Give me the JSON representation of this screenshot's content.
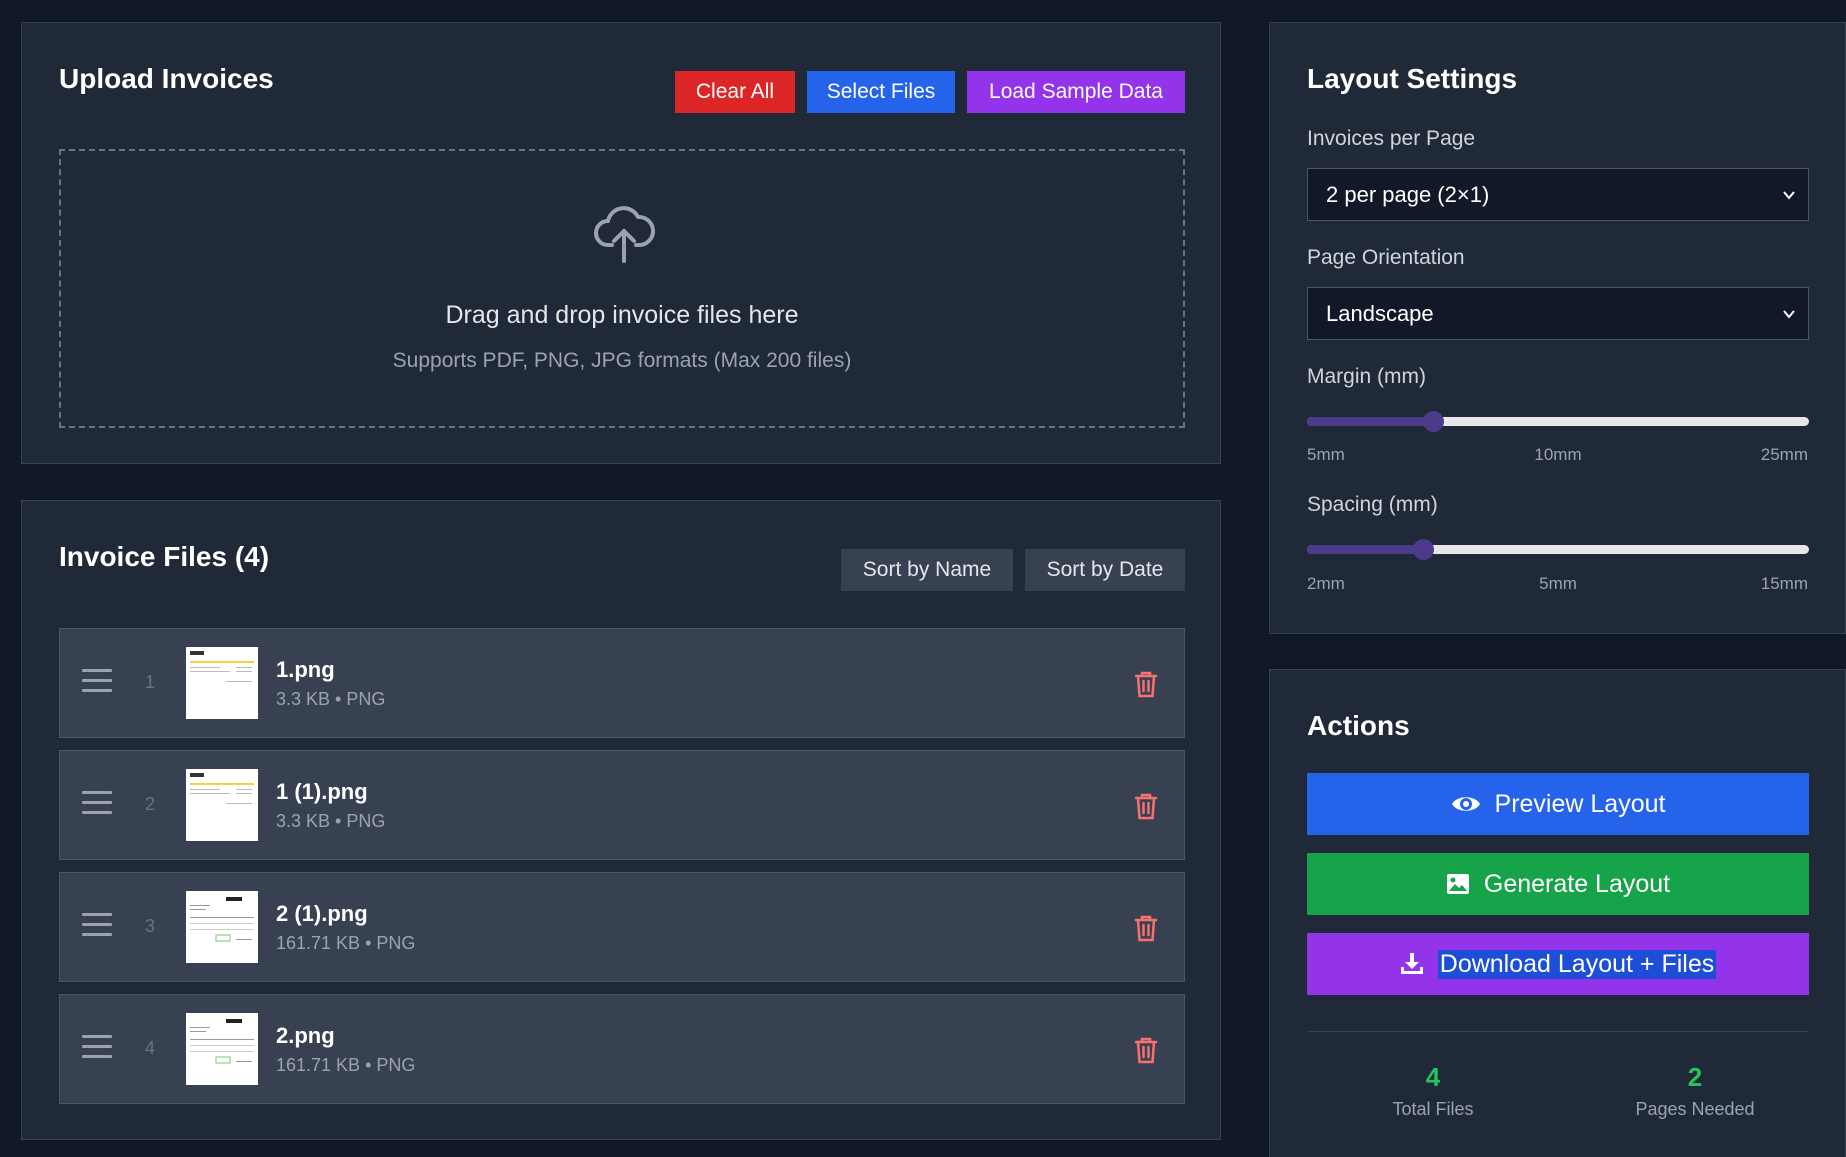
{
  "upload": {
    "title": "Upload Invoices",
    "clear_all": "Clear All",
    "select_files": "Select Files",
    "load_sample": "Load Sample Data",
    "drop_title": "Drag and drop invoice files here",
    "drop_subtitle": "Supports PDF, PNG, JPG formats (Max 200 files)"
  },
  "files": {
    "title": "Invoice Files (4)",
    "sort_name": "Sort by Name",
    "sort_date": "Sort by Date",
    "items": [
      {
        "index": "1",
        "name": "1.png",
        "meta": "3.3 KB • PNG"
      },
      {
        "index": "2",
        "name": "1 (1).png",
        "meta": "3.3 KB • PNG"
      },
      {
        "index": "3",
        "name": "2 (1).png",
        "meta": "161.71 KB • PNG"
      },
      {
        "index": "4",
        "name": "2.png",
        "meta": "161.71 KB • PNG"
      }
    ]
  },
  "layout": {
    "title": "Layout Settings",
    "per_page_label": "Invoices per Page",
    "per_page_value": "2 per page (2×1)",
    "orientation_label": "Page Orientation",
    "orientation_value": "Landscape",
    "margin_label": "Margin (mm)",
    "margin_ticks": [
      "5mm",
      "10mm",
      "25mm"
    ],
    "margin_value": 10,
    "margin_range": [
      5,
      25
    ],
    "spacing_label": "Spacing (mm)",
    "spacing_ticks": [
      "2mm",
      "5mm",
      "15mm"
    ],
    "spacing_value": 5,
    "spacing_range": [
      2,
      15
    ]
  },
  "actions": {
    "title": "Actions",
    "preview": "Preview Layout",
    "generate": "Generate Layout",
    "download": "Download Layout + Files",
    "total_files_value": "4",
    "total_files_label": "Total Files",
    "pages_needed_value": "2",
    "pages_needed_label": "Pages Needed"
  },
  "colors": {
    "background": "#111827",
    "panel": "#1f2937",
    "danger": "#dc2626",
    "primary": "#2563eb",
    "accent": "#9333ea",
    "success": "#16a34a",
    "stat": "#22c55e"
  }
}
